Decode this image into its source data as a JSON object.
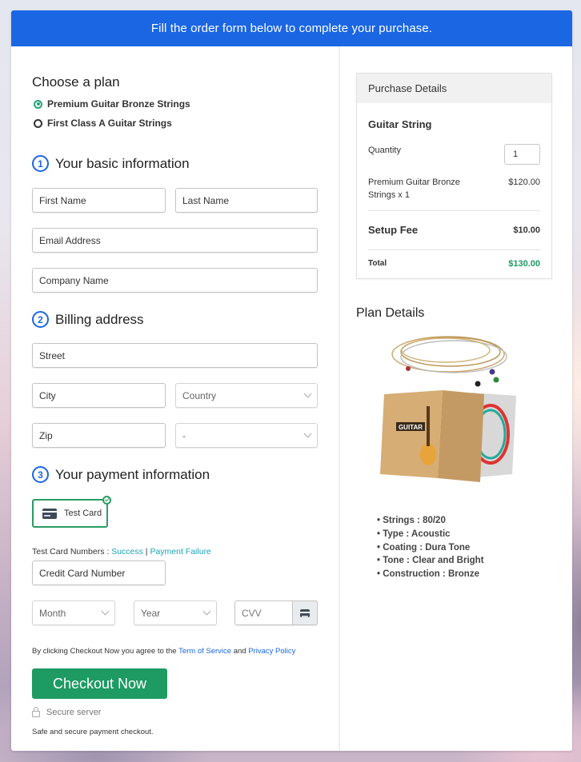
{
  "banner": {
    "text": "Fill the order form below to complete your purchase."
  },
  "plan": {
    "heading": "Choose a plan",
    "options": [
      {
        "label": "Premium Guitar Bronze Strings",
        "selected": true
      },
      {
        "label": "First Class A Guitar Strings",
        "selected": false
      }
    ]
  },
  "basic": {
    "step": "1",
    "heading": "Your basic information",
    "first_name_placeholder": "First Name",
    "last_name_placeholder": "Last Name",
    "email_placeholder": "Email Address",
    "company_placeholder": "Company Name"
  },
  "billing": {
    "step": "2",
    "heading": "Billing address",
    "street_placeholder": "Street",
    "city_placeholder": "City",
    "country_select": "Country",
    "zip_placeholder": "Zip",
    "state_select": "-"
  },
  "payment": {
    "step": "3",
    "heading": "Your payment information",
    "method_label": "Test Card",
    "test_numbers_label": "Test Card Numbers : ",
    "success_link": "Success",
    "separator": " | ",
    "failure_link": "Payment Failure",
    "card_number_placeholder": "Credit Card Number",
    "month_select": "Month",
    "year_select": "Year",
    "cvv_placeholder": "CVV",
    "terms_prefix": "By clicking Checkout Now you agree to the ",
    "terms_link": "Term of Service",
    "terms_and": " and ",
    "privacy_link": "Privacy Policy",
    "checkout_label": "Checkout Now",
    "secure_label": "Secure server",
    "safe_text": "Safe and secure payment checkout."
  },
  "purchase": {
    "heading": "Purchase Details",
    "product": "Guitar String",
    "quantity_label": "Quantity",
    "quantity_value": "1",
    "line_item_label": "Premium Guitar Bronze Strings x 1",
    "line_item_price": "$120.00",
    "setup_fee_label": "Setup Fee",
    "setup_fee_price": "$10.00",
    "total_label": "Total",
    "total_price": "$130.00",
    "total_color": "#1e9a63"
  },
  "plan_details": {
    "heading": "Plan Details",
    "features": [
      "Strings : 80/20",
      "Type : Acoustic",
      "Coating : Dura Tone",
      "Tone : Clear and Bright",
      "Construction : Bronze"
    ]
  },
  "colors": {
    "brand_blue": "#1b66e3",
    "checkout_green": "#1e9a63"
  }
}
